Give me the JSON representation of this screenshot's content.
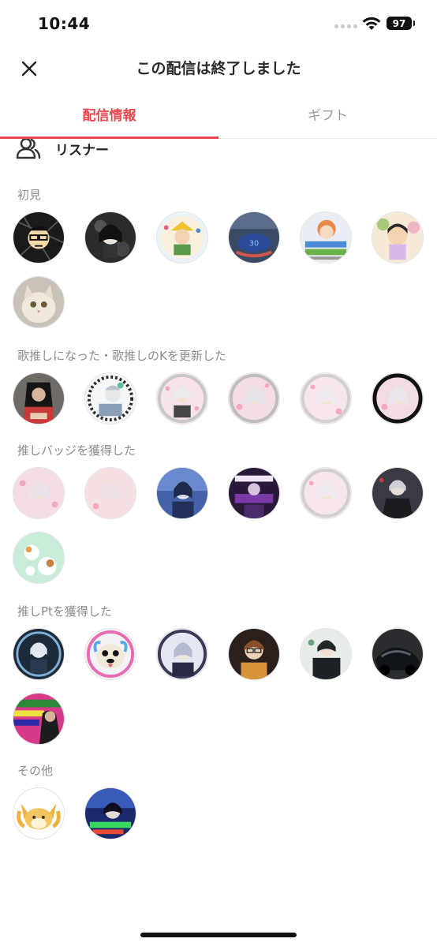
{
  "status_bar": {
    "time": "10:44",
    "battery": "97"
  },
  "header": {
    "title": "この配信は終了しました"
  },
  "tabs": [
    {
      "label": "配信情報",
      "active": true
    },
    {
      "label": "ギフト",
      "active": false
    }
  ],
  "listener_section": {
    "title": "リスナー",
    "groups": [
      {
        "label": "初見"
      },
      {
        "label": "歌推しになった・歌推しのKを更新した"
      },
      {
        "label": "推しバッジを獲得した"
      },
      {
        "label": "推しPtを獲得した"
      },
      {
        "label": "その他"
      }
    ]
  },
  "colors": {
    "accent": "#e8484f",
    "label_gray": "#8c8c8c"
  }
}
